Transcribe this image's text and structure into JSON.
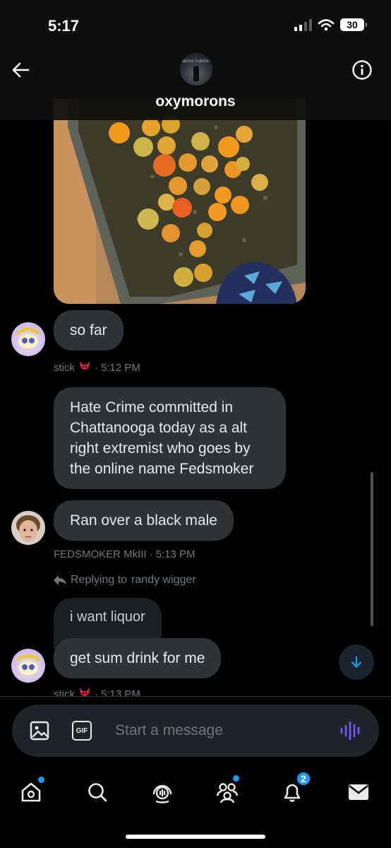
{
  "status_bar": {
    "time": "5:17",
    "battery": "30"
  },
  "header": {
    "title": "oxymorons",
    "avatar_text": "MEDS TAKEN?"
  },
  "messages": [
    {
      "text": "so far",
      "sender": "stick",
      "time": "5:12 PM"
    },
    {
      "text": "Hate Crime committed in Chattanooga today as a alt right extremist who goes by the online name Fedsmoker"
    },
    {
      "text": "Ran over a black male",
      "sender": "FEDSMOKER MkIII",
      "time": "5:13 PM"
    },
    {
      "reply_prefix": "Replying to",
      "reply_target": "randy wigger",
      "text": "i want liquor"
    },
    {
      "text": "get sum drink for me",
      "sender": "stick",
      "time": "5:13 PM"
    }
  ],
  "meta_separator": "·",
  "composer": {
    "placeholder": "Start a message",
    "gif_label": "GIF"
  },
  "tabbar": {
    "notifications_badge": "2"
  },
  "colors": {
    "accent": "#1d9bf0",
    "bubble": "#2f3336",
    "muted": "#71767b",
    "voice": "#7856ff"
  },
  "icons": [
    "back-arrow-icon",
    "info-icon",
    "image-icon",
    "gif-icon",
    "voice-waveform-icon",
    "home-icon",
    "search-icon",
    "spaces-icon",
    "communities-icon",
    "bell-icon",
    "mail-icon",
    "arrow-down-icon",
    "reply-arrow-icon",
    "red-devil-emoji-icon"
  ]
}
